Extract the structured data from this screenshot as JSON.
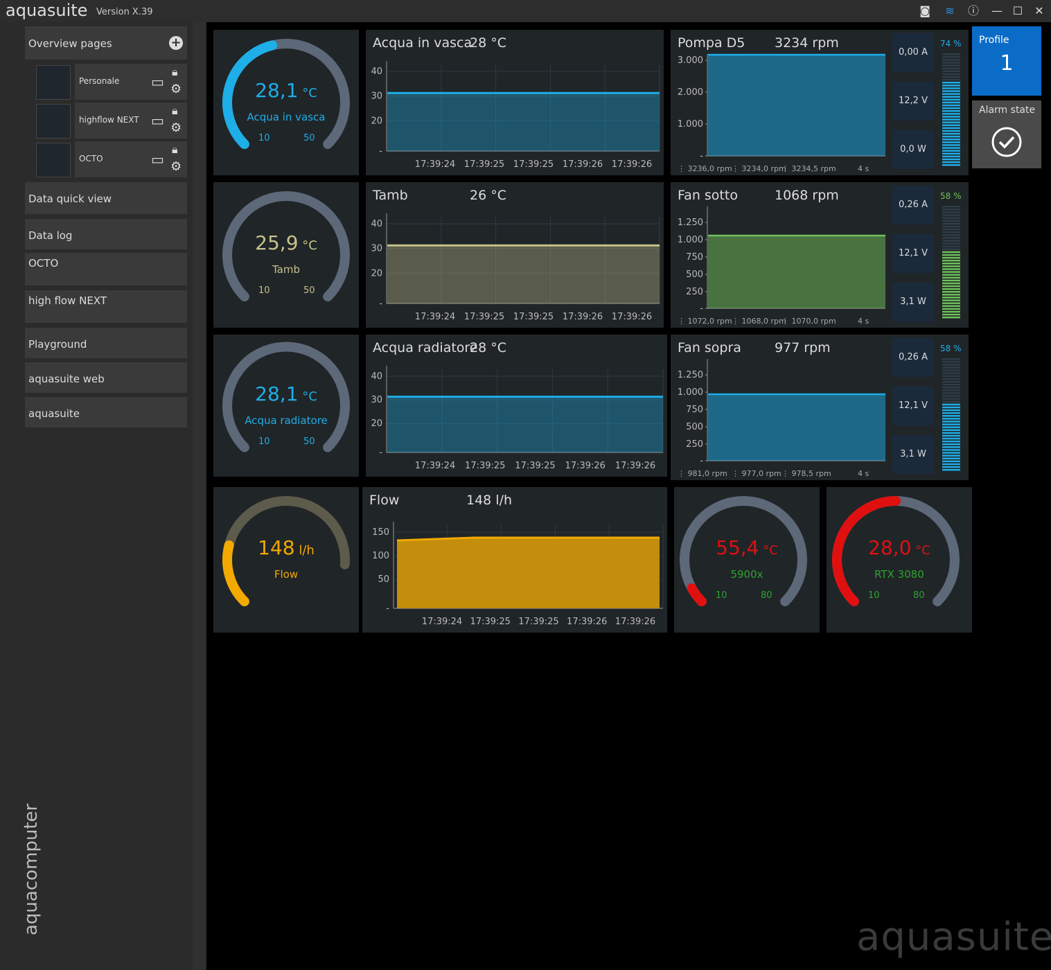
{
  "app": {
    "name": "aquasuite",
    "version": "Version X.39",
    "watermark": "aquasuite",
    "brand": "aquacomputer"
  },
  "titlebar": {
    "icons": [
      "camera-icon",
      "layers-icon",
      "info-icon",
      "minimize-icon",
      "maximize-icon",
      "close-icon"
    ]
  },
  "sidebar": {
    "overview_header": "Overview pages",
    "pages": [
      {
        "label": "Personale"
      },
      {
        "label": "highflow NEXT"
      },
      {
        "label": "OCTO"
      }
    ],
    "items": [
      "Data quick view",
      "Data log",
      "OCTO",
      "high flow NEXT",
      "Playground",
      "aquasuite web",
      "aquasuite"
    ]
  },
  "gauges": [
    {
      "value": "28,1",
      "unit": "°C",
      "label": "Acqua in vasca",
      "min": "10",
      "max": "50",
      "color": "#1eaee8",
      "level": 0.45
    },
    {
      "value": "25,9",
      "unit": "°C",
      "label": "Tamb",
      "min": "10",
      "max": "50",
      "color": "#c7c28a",
      "level": 0.0
    },
    {
      "value": "28,1",
      "unit": "°C",
      "label": "Acqua radiatore",
      "min": "10",
      "max": "50",
      "color": "#1eaee8",
      "level": 0.0
    },
    {
      "value": "148",
      "unit": "l/h",
      "label": "Flow",
      "min": "",
      "max": "",
      "color": "#f2a900",
      "level": 0.22
    },
    {
      "value": "55,4",
      "unit": "°C",
      "label": "5900x",
      "min": "10",
      "max": "80",
      "color": "#e01010",
      "labelcolor": "#2ea32e",
      "level": 0.06
    },
    {
      "value": "28,0",
      "unit": "°C",
      "label": "RTX 3080",
      "min": "10",
      "max": "80",
      "color": "#e01010",
      "labelcolor": "#2ea32e",
      "level": 0.5
    }
  ],
  "temp_charts": [
    {
      "title": "Acqua in vasca",
      "value": "28 °C",
      "color": "#1eaee8",
      "yticks": [
        "40",
        "30",
        "20",
        "-"
      ],
      "x": [
        "17:39:24",
        "17:39:25",
        "17:39:25",
        "17:39:26",
        "17:39:26"
      ]
    },
    {
      "title": "Tamb",
      "value": "26 °C",
      "color": "#c7c28a",
      "yticks": [
        "40",
        "30",
        "20",
        "-"
      ],
      "x": [
        "17:39:24",
        "17:39:25",
        "17:39:25",
        "17:39:26",
        "17:39:26"
      ]
    },
    {
      "title": "Acqua radiatore",
      "value": "28 °C",
      "color": "#1eaee8",
      "yticks": [
        "40",
        "30",
        "20",
        "-"
      ],
      "x": [
        "17:39:24",
        "17:39:25",
        "17:39:25",
        "17:39:26",
        "17:39:26"
      ]
    },
    {
      "title": "Flow",
      "value": "148 l/h",
      "color": "#f2a900",
      "yticks": [
        "150",
        "100",
        "50",
        "-"
      ],
      "x": [
        "17:39:24",
        "17:39:25",
        "17:39:25",
        "17:39:26",
        "17:39:26"
      ]
    }
  ],
  "fan_charts": [
    {
      "title": "Pompa D5",
      "value": "3234 rpm",
      "color": "#1eaee8",
      "yticks": [
        "3.000",
        "2.000",
        "1.000",
        "-"
      ],
      "amps": "0,00 A",
      "volts": "12,2 V",
      "watts": "0,0 W",
      "pct": "74 %",
      "pct_level": 0.74,
      "legend": [
        "3236,0 rpm",
        "3234,0 rpm",
        "3234,5 rpm",
        "4 s"
      ]
    },
    {
      "title": "Fan sotto",
      "value": "1068 rpm",
      "color": "#6fc25a",
      "yticks": [
        "1.250",
        "1.000",
        "750",
        "500",
        "250",
        "-"
      ],
      "amps": "0,26 A",
      "volts": "12,1 V",
      "watts": "3,1 W",
      "pct": "58 %",
      "pct_level": 0.58,
      "legend": [
        "1072,0 rpm",
        "1068,0 rpm",
        "1070,0 rpm",
        "4 s"
      ]
    },
    {
      "title": "Fan sopra",
      "value": "977 rpm",
      "color": "#1eaee8",
      "yticks": [
        "1.250",
        "1.000",
        "750",
        "500",
        "250",
        "-"
      ],
      "amps": "0,26 A",
      "volts": "12,1 V",
      "watts": "3,1 W",
      "pct": "58 %",
      "pct_level": 0.58,
      "legend": [
        "981,0 rpm",
        "977,0 rpm",
        "978,5 rpm",
        "4 s"
      ]
    }
  ],
  "profile": {
    "label": "Profile",
    "value": "1"
  },
  "alarm": {
    "label": "Alarm state"
  }
}
